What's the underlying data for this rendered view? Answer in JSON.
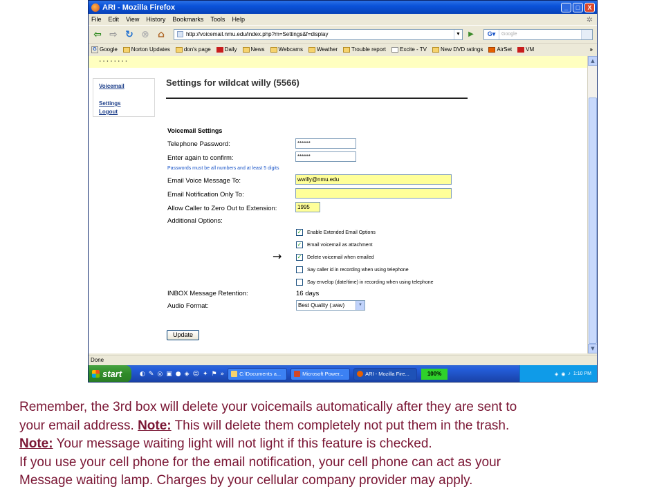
{
  "window": {
    "title": "ARI - Mozilla Firefox",
    "controls": {
      "minimize": "_",
      "maximize": "□",
      "close": "X"
    }
  },
  "menu": [
    "File",
    "Edit",
    "View",
    "History",
    "Bookmarks",
    "Tools",
    "Help"
  ],
  "address": {
    "url": "http://voicemail.nmu.edu/index.php?m=Settings&f=display",
    "search_placeholder": "Google"
  },
  "bookmarks": [
    {
      "label": "Google",
      "icon": "google-icon"
    },
    {
      "label": "Norton Updates",
      "icon": "folder-icon"
    },
    {
      "label": "don's page",
      "icon": "folder-icon"
    },
    {
      "label": "Daily",
      "icon": "red-icon"
    },
    {
      "label": "News",
      "icon": "folder-icon"
    },
    {
      "label": "Webcams",
      "icon": "folder-icon"
    },
    {
      "label": "Weather",
      "icon": "folder-icon"
    },
    {
      "label": "Trouble report",
      "icon": "folder-icon"
    },
    {
      "label": "Excite - TV",
      "icon": "page-icon"
    },
    {
      "label": "New DVD ratings",
      "icon": "folder-icon"
    },
    {
      "label": "AirSet",
      "icon": "page-icon"
    },
    {
      "label": "VM",
      "icon": "red-icon"
    }
  ],
  "notice": "........",
  "leftnav": {
    "voicemail": "Voicemail",
    "settings": "Settings",
    "logout": "Logout"
  },
  "page": {
    "title": "Settings for wildcat willy (5566)"
  },
  "form": {
    "section": "Voicemail Settings",
    "telephone_password_label": "Telephone Password:",
    "telephone_password_value": "******",
    "confirm_label": "Enter again to confirm:",
    "confirm_value": "******",
    "password_hint": "Passwords must be all numbers and at least 5 digits",
    "email_voice_label": "Email Voice Message To:",
    "email_voice_value": "wwilly@nmu.edu",
    "email_notify_label": "Email Notification Only To:",
    "email_notify_value": "",
    "zero_out_label": "Allow Caller to Zero Out to Extension:",
    "zero_out_value": "1995",
    "additional_label": "Additional Options:",
    "options": [
      {
        "label": "Enable Extended Email Options",
        "checked": true
      },
      {
        "label": "Email voicemail as attachment",
        "checked": true
      },
      {
        "label": "Delete voicemail when emailed",
        "checked": true
      },
      {
        "label": "Say caller id in recording when using telephone",
        "checked": false
      },
      {
        "label": "Say envelop (date/time) in recording when using telephone",
        "checked": false
      }
    ],
    "retention_label": "INBOX Message Retention:",
    "retention_value": "16 days",
    "audio_label": "Audio Format:",
    "audio_value": "Best Quality (.wav)",
    "update_button": "Update"
  },
  "status": "Done",
  "taskbar": {
    "start": "start",
    "tasks": [
      {
        "label": "C:\\Documents a...",
        "color": "#f6d36e"
      },
      {
        "label": "Microsoft Power...",
        "color": "#d24726"
      },
      {
        "label": "ARI - Mozilla Fire...",
        "color": "#e66000"
      }
    ],
    "percent": "100%",
    "time": "1:10 PM"
  },
  "caption": {
    "line1": "Remember, the 3rd box will delete your voicemails automatically after they are sent to",
    "line2_pre": "your email address. ",
    "note1": "Note:",
    "line2_post": " This will delete them completely not put them in the trash.",
    "note2": "Note:",
    "line3_post": " Your message waiting light will not light if this feature is checked.",
    "line4": "If you use your cell phone for the email notification, your cell phone can act as your",
    "line5": "Message waiting lamp.  Charges by your cellular company provider may apply."
  }
}
